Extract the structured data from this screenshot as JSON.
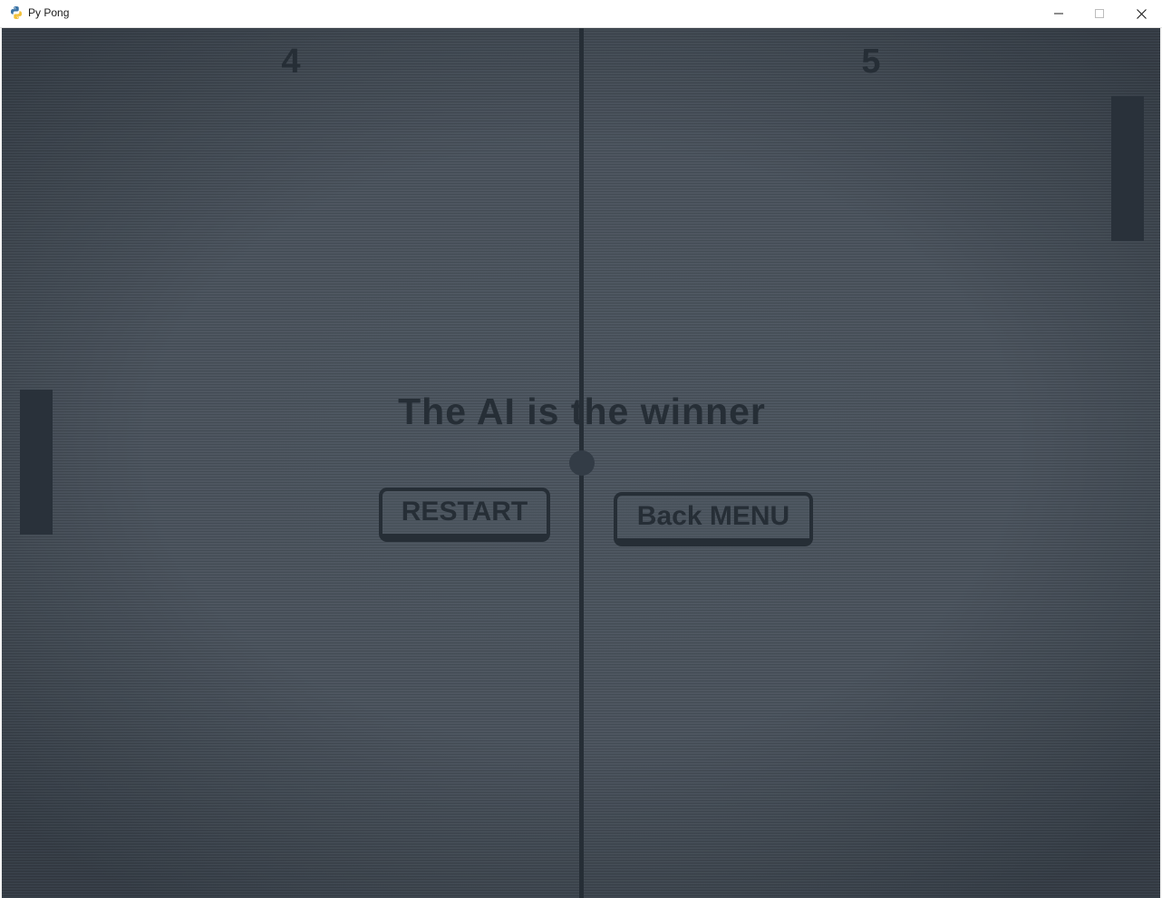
{
  "window": {
    "title": "Py Pong",
    "icon": "python-icon",
    "controls": {
      "minimize_icon": "minimize-icon",
      "maximize_icon": "maximize-icon",
      "close_icon": "close-icon"
    }
  },
  "game": {
    "score_left": "4",
    "score_right": "5",
    "winner_message": "The AI is the winner",
    "buttons": {
      "restart_label": "RESTART",
      "back_menu_label": "Back MENU"
    }
  },
  "colors": {
    "background": "#4a535d",
    "foreground": "#262e36"
  }
}
